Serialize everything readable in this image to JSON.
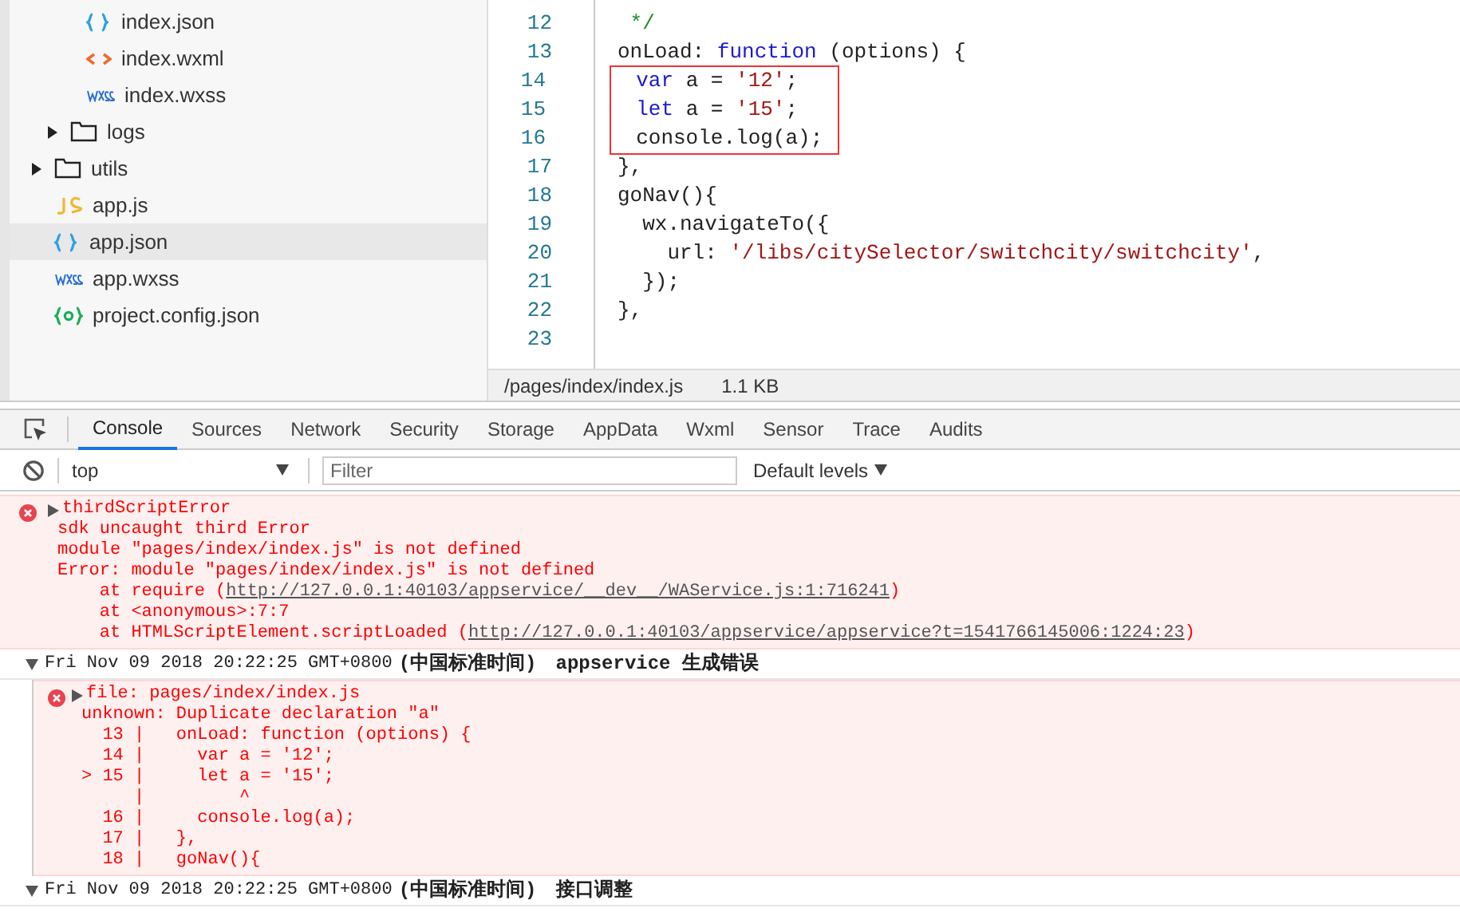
{
  "file_tree": [
    {
      "children": [
        {
          "children": [
            {
              "label": "index.json",
              "kind": "json",
              "selected": false
            },
            {
              "label": "index.wxml",
              "kind": "wxml",
              "selected": false
            },
            {
              "label": "index.wxss",
              "kind": "wxss",
              "selected": false
            }
          ]
        },
        {
          "label": "logs",
          "kind": "folder",
          "expanded": false,
          "selected": false
        }
      ]
    },
    {
      "label": "utils",
      "kind": "folder",
      "expanded": false,
      "selected": false
    },
    {
      "label": "app.js",
      "kind": "js",
      "selected": false
    },
    {
      "label": "app.json",
      "kind": "json",
      "selected": true
    },
    {
      "label": "app.wxss",
      "kind": "wxss",
      "selected": false
    },
    {
      "label": "project.config.json",
      "kind": "config",
      "selected": false
    }
  ],
  "editor": {
    "lines": [
      {
        "number": "12",
        "boxed": false,
        "tokens": [
          {
            "text": " */",
            "kind": "comment"
          }
        ]
      },
      {
        "number": "13",
        "boxed": false,
        "tokens": [
          {
            "text": "onLoad: ",
            "kind": "plain"
          },
          {
            "text": "function",
            "kind": "keyword"
          },
          {
            "text": " (options) {",
            "kind": "plain"
          }
        ]
      },
      {
        "number": "14",
        "boxed": true,
        "tokens": [
          {
            "text": "  var",
            "kind": "keyword"
          },
          {
            "text": " a = ",
            "kind": "plain"
          },
          {
            "text": "'12'",
            "kind": "string"
          },
          {
            "text": ";",
            "kind": "plain"
          }
        ]
      },
      {
        "number": "15",
        "boxed": true,
        "tokens": [
          {
            "text": "  let",
            "kind": "keyword"
          },
          {
            "text": " a = ",
            "kind": "plain"
          },
          {
            "text": "'15'",
            "kind": "string"
          },
          {
            "text": ";",
            "kind": "plain"
          }
        ]
      },
      {
        "number": "16",
        "boxed": true,
        "tokens": [
          {
            "text": "  console.log(a);",
            "kind": "plain"
          }
        ]
      },
      {
        "number": "17",
        "boxed": false,
        "tokens": [
          {
            "text": "},",
            "kind": "plain"
          }
        ]
      },
      {
        "number": "18",
        "boxed": false,
        "tokens": [
          {
            "text": "goNav(){",
            "kind": "plain"
          }
        ]
      },
      {
        "number": "19",
        "boxed": false,
        "tokens": [
          {
            "text": "  wx.navigateTo({",
            "kind": "plain"
          }
        ]
      },
      {
        "number": "20",
        "boxed": false,
        "tokens": [
          {
            "text": "    url: ",
            "kind": "plain"
          },
          {
            "text": "'/libs/citySelector/switchcity/switchcity'",
            "kind": "string"
          },
          {
            "text": ",",
            "kind": "plain"
          }
        ]
      },
      {
        "number": "21",
        "boxed": false,
        "tokens": [
          {
            "text": "  });",
            "kind": "plain"
          }
        ]
      },
      {
        "number": "22",
        "boxed": false,
        "tokens": [
          {
            "text": "},",
            "kind": "plain"
          }
        ]
      },
      {
        "number": "23",
        "boxed": false
      }
    ],
    "status_bar": {
      "path": "/pages/index/index.js",
      "size": "1.1 KB"
    }
  },
  "devtools": {
    "tabs": [
      {
        "label": "Console",
        "selected": true
      },
      {
        "label": "Sources",
        "selected": false
      },
      {
        "label": "Network",
        "selected": false
      },
      {
        "label": "Security",
        "selected": false
      },
      {
        "label": "Storage",
        "selected": false
      },
      {
        "label": "AppData",
        "selected": false
      },
      {
        "label": "Wxml",
        "selected": false
      },
      {
        "label": "Sensor",
        "selected": false
      },
      {
        "label": "Trace",
        "selected": false
      },
      {
        "label": "Audits",
        "selected": false
      }
    ],
    "context": "top",
    "filter_placeholder": "Filter",
    "levels": "Default levels",
    "messages": [
      {
        "kind": "error",
        "expanded": false,
        "title": "thirdScriptError",
        "lines": [
          [
            {
              "text": "sdk uncaught third Error"
            }
          ],
          [
            {
              "text": "module \"pages/index/index.js\" is not defined"
            }
          ],
          [
            {
              "text": "Error: module \"pages/index/index.js\" is not defined"
            }
          ],
          [
            {
              "text": "    at require ("
            },
            {
              "text": "http://127.0.0.1:40103/appservice/__dev__/WAService.js:1:716241",
              "link": true
            },
            {
              "text": ")"
            }
          ],
          [
            {
              "text": "    at <anonymous>:7:7"
            }
          ],
          [
            {
              "text": "    at HTMLScriptElement.scriptLoaded ("
            },
            {
              "text": "http://127.0.0.1:40103/appservice/appservice?t=1541766145006:1224:23",
              "link": true
            },
            {
              "text": ")"
            }
          ]
        ]
      },
      {
        "kind": "group",
        "expanded": true,
        "timestamp": "Fri Nov 09 2018 20:22:25 GMT+0800",
        "zone": "(中国标准时间)",
        "label": "appservice 生成错误",
        "children": [
          {
            "kind": "error",
            "expanded": false,
            "title": "file: pages/index/index.js",
            "lines": [
              [
                {
                  "text": "unknown: Duplicate declaration \"a\""
                }
              ],
              [
                {
                  "text": "  13 |   onLoad: function (options) {"
                }
              ],
              [
                {
                  "text": "  14 |     var a = '12';"
                }
              ],
              [
                {
                  "text": "> 15 |     let a = '15';"
                }
              ],
              [
                {
                  "text": "     |         ^"
                }
              ],
              [
                {
                  "text": "  16 |     console.log(a);"
                }
              ],
              [
                {
                  "text": "  17 |   },"
                }
              ],
              [
                {
                  "text": "  18 |   goNav(){"
                }
              ]
            ]
          }
        ]
      },
      {
        "kind": "group",
        "expanded": true,
        "timestamp": "Fri Nov 09 2018 20:22:25 GMT+0800",
        "zone": "(中国标准时间)",
        "label": "接口调整"
      }
    ]
  }
}
